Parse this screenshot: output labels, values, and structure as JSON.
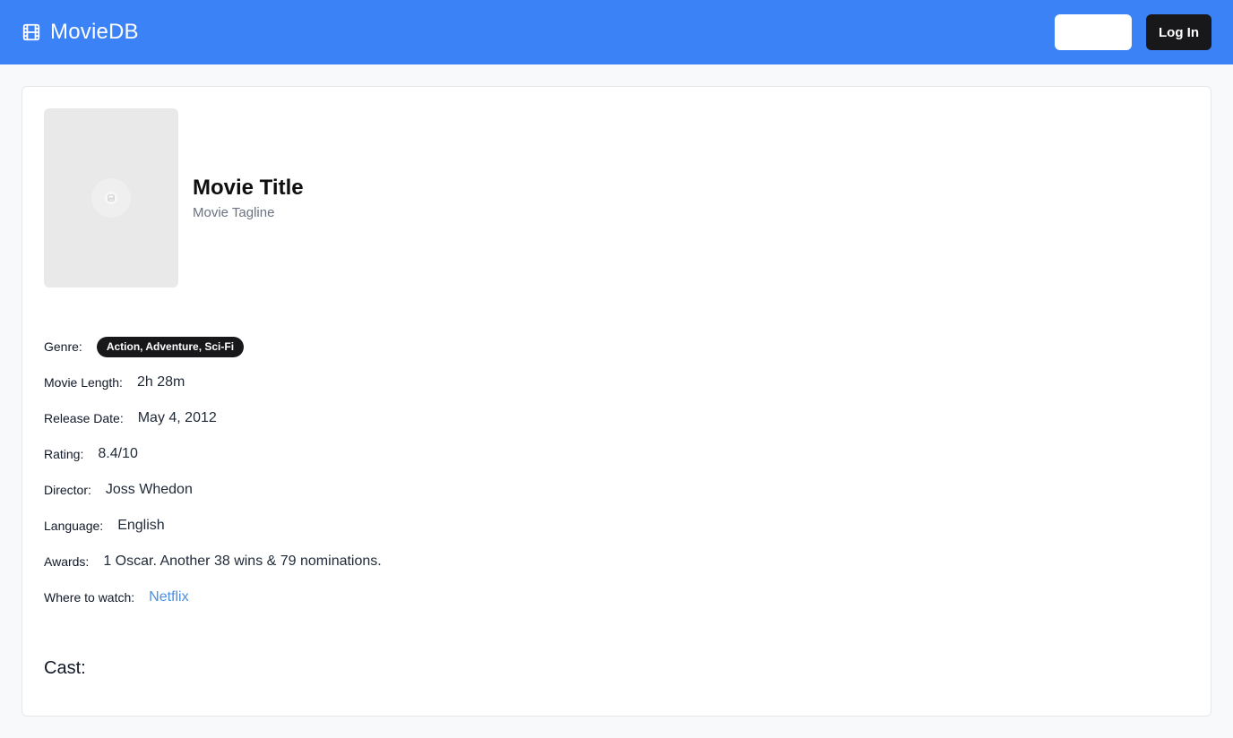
{
  "header": {
    "brand": "MovieDB",
    "brand_icon": "film-icon",
    "blank_button_label": "",
    "login_label": "Log In",
    "colors": {
      "bar": "#3b82f6",
      "login_bg": "#18181b"
    }
  },
  "movie": {
    "title": "Movie Title",
    "tagline": "Movie Tagline",
    "poster_icon": "image-placeholder-icon"
  },
  "details": {
    "genre_label": "Genre:",
    "genre_value": "Action, Adventure, Sci-Fi",
    "length_label": "Movie Length:",
    "length_value": "2h 28m",
    "release_label": "Release Date:",
    "release_value": "May 4, 2012",
    "rating_label": "Rating:",
    "rating_value": "8.4/10",
    "director_label": "Director:",
    "director_value": "Joss Whedon",
    "language_label": "Language:",
    "language_value": "English",
    "awards_label": "Awards:",
    "awards_value": "1 Oscar. Another 38 wins & 79 nominations.",
    "watch_label": "Where to watch:",
    "watch_value": "Netflix"
  },
  "cast": {
    "heading": "Cast:"
  }
}
